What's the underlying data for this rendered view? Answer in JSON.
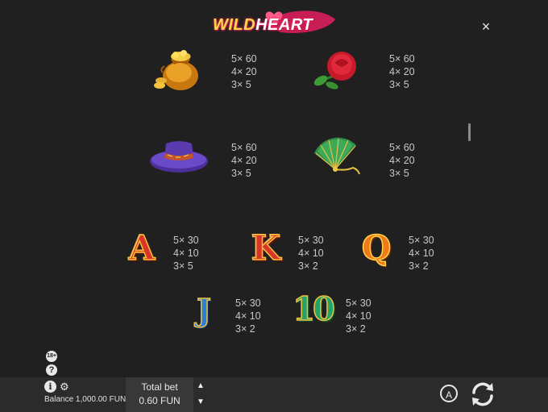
{
  "header": {
    "logo_wild": "WILD",
    "logo_heart": "HEART",
    "close_label": "×"
  },
  "paytable": {
    "high": [
      {
        "symbol": "gold-bag",
        "pays": [
          "5× 60",
          "4× 20",
          "3× 5"
        ]
      },
      {
        "symbol": "rose",
        "pays": [
          "5× 60",
          "4× 20",
          "3× 5"
        ]
      },
      {
        "symbol": "hat",
        "pays": [
          "5× 60",
          "4× 20",
          "3× 5"
        ]
      },
      {
        "symbol": "fan",
        "pays": [
          "5× 60",
          "4× 20",
          "3× 5"
        ]
      }
    ],
    "low": [
      {
        "symbol": "A",
        "pays": [
          "5× 30",
          "4× 10",
          "3× 5"
        ]
      },
      {
        "symbol": "K",
        "pays": [
          "5× 30",
          "4× 10",
          "3× 2"
        ]
      },
      {
        "symbol": "Q",
        "pays": [
          "5× 30",
          "4× 10",
          "3× 2"
        ]
      },
      {
        "symbol": "J",
        "pays": [
          "5× 30",
          "4× 10",
          "3× 2"
        ]
      },
      {
        "symbol": "10",
        "pays": [
          "5× 30",
          "4× 10",
          "3× 2"
        ]
      }
    ]
  },
  "side": {
    "age_icon": "18+",
    "help_label": "?"
  },
  "bottom_bar": {
    "info_label": "i",
    "settings_icon": "gear-icon",
    "balance_text": "Balance 1,000.00 FUN",
    "total_bet_label": "Total bet",
    "total_bet_value": "0.60 FUN",
    "up_arrow": "▲",
    "down_arrow": "▼",
    "auto_label": "A"
  },
  "colors": {
    "background": "#202020",
    "bar": "#2b2b2b",
    "bet_box": "#383838"
  }
}
